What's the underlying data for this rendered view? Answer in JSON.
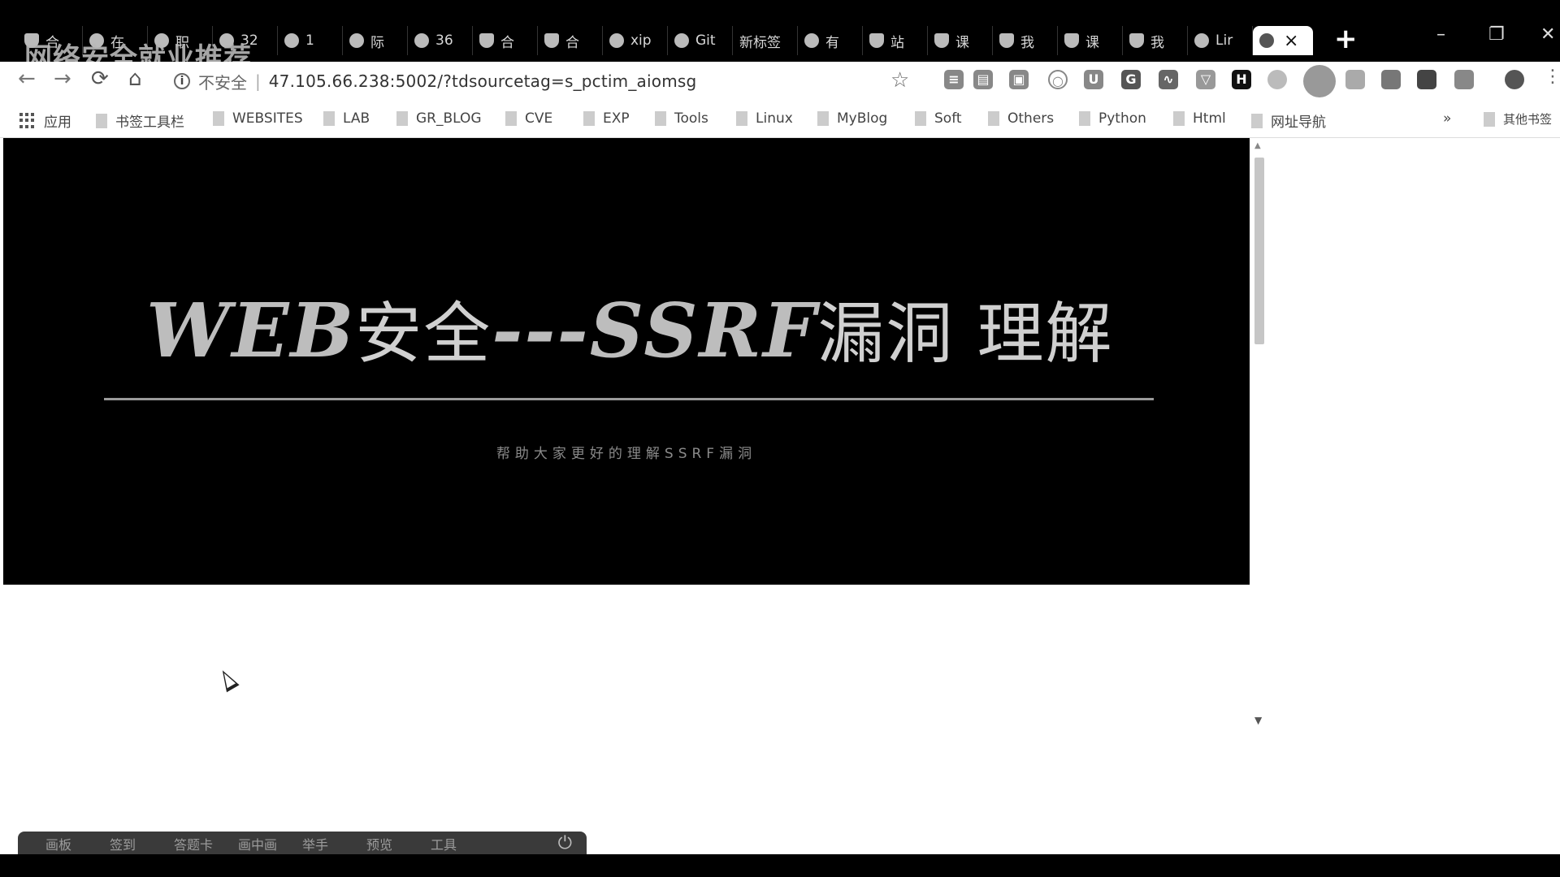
{
  "watermark": "网络安全就业推荐",
  "tabs": [
    {
      "label": "合",
      "kind": "shield"
    },
    {
      "label": "在",
      "kind": "g"
    },
    {
      "label": "职",
      "kind": "round"
    },
    {
      "label": "32",
      "kind": "g"
    },
    {
      "label": "1",
      "kind": "round"
    },
    {
      "label": "际",
      "kind": "round"
    },
    {
      "label": "36",
      "kind": "round"
    },
    {
      "label": "合",
      "kind": "shield"
    },
    {
      "label": "合",
      "kind": "shield"
    },
    {
      "label": "xip",
      "kind": "square"
    },
    {
      "label": "Git",
      "kind": "round"
    },
    {
      "label": "新标签",
      "kind": "none"
    },
    {
      "label": "有",
      "kind": "square"
    },
    {
      "label": "站",
      "kind": "shield"
    },
    {
      "label": "课",
      "kind": "shield"
    },
    {
      "label": "我",
      "kind": "shield"
    },
    {
      "label": "课",
      "kind": "shield"
    },
    {
      "label": "我",
      "kind": "shield"
    },
    {
      "label": "Lir",
      "kind": "square"
    }
  ],
  "active_tab": {
    "close": "×"
  },
  "new_tab": "+",
  "window": {
    "minimize": "–",
    "restore": "❐",
    "close": "✕"
  },
  "nav": {
    "back": "←",
    "forward": "→",
    "reload": "⟳",
    "home": "⌂"
  },
  "omnibox": {
    "info_icon": "i",
    "security": "不安全",
    "separator": "|",
    "url": "47.105.66.238:5002/?tdsourcetag=s_pctim_aiomsg",
    "star": "☆"
  },
  "extensions": [
    "≡",
    "▤",
    "▣",
    "○",
    "U",
    "G",
    "∿",
    "▽",
    "H"
  ],
  "bookmarks": {
    "apps": "应用",
    "items": [
      "书签工具栏",
      "WEBSITES",
      "LAB",
      "GR_BLOG",
      "CVE",
      "EXP",
      "Tools",
      "Linux",
      "MyBlog",
      "Soft",
      "Others",
      "Python",
      "Html",
      "网址导航"
    ],
    "more": "»",
    "other": "其他书签"
  },
  "hero": {
    "title_latin_1": "WEB",
    "title_cjk_1": "安全",
    "title_dash": "---",
    "title_latin_2": "SSRF",
    "title_cjk_2": "漏洞 理解",
    "subtitle": "帮助大家更好的理解SSRF漏洞"
  },
  "scroll": {
    "up": "▲",
    "down": "▼"
  },
  "dock": {
    "items": [
      "画板",
      "签到",
      "答题卡",
      "画中画",
      "举手",
      "预览",
      "工具"
    ],
    "power": "⏻"
  },
  "colors": {
    "page_bg": "#ffffff",
    "hero_bg": "#000000",
    "title_color": "#c8c8c8"
  }
}
